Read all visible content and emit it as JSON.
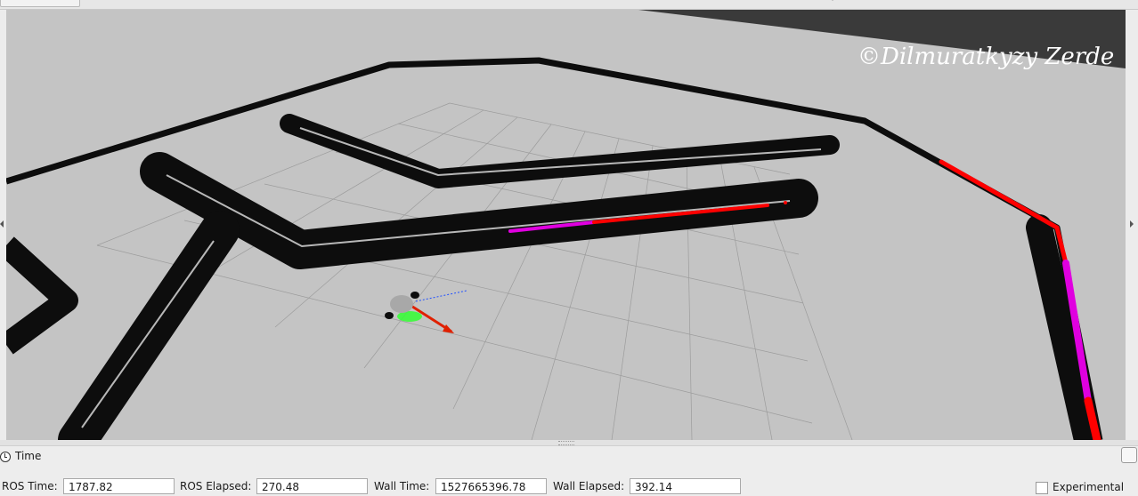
{
  "viewport": {
    "watermark": "©Dilmuratkyzy Zerde",
    "colors": {
      "background": "#c4c4c4",
      "dark_corner": "#3a3a3a",
      "obstacle": "#0d0d0d",
      "grid": "#9c9c9c",
      "global_path": "#ff0000",
      "local_path": "#e000e0",
      "robot_body": "#a8a8a8",
      "particles": "#33ff33",
      "pose_arrow": "#e02000",
      "axis_blue": "#2050ff"
    }
  },
  "time_panel": {
    "title": "Time",
    "icon": "clock-icon",
    "ros_time_label": "ROS Time:",
    "ros_time_value": "1787.82",
    "ros_elapsed_label": "ROS Elapsed:",
    "ros_elapsed_value": "270.48",
    "wall_time_label": "Wall Time:",
    "wall_time_value": "1527665396.78",
    "wall_elapsed_label": "Wall Elapsed:",
    "wall_elapsed_value": "392.14",
    "experimental_label": "Experimental",
    "experimental_checked": false
  }
}
